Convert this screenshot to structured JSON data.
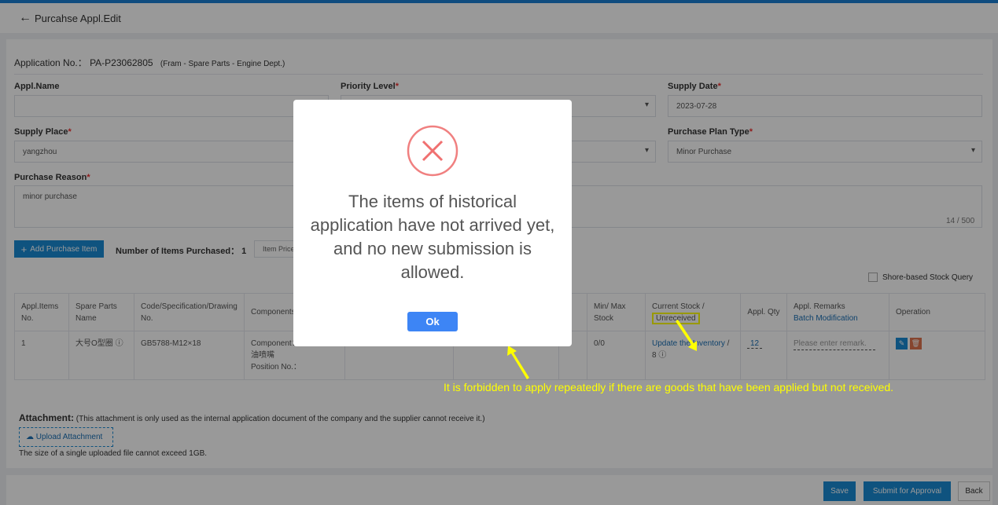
{
  "header": {
    "title": "Purcahse Appl.Edit"
  },
  "application": {
    "label": "Application No.：",
    "number": "PA-P23062805",
    "dept": "(Fram - Spare Parts - Engine Dept.)"
  },
  "form": {
    "appl_name": {
      "label": "Appl.Name",
      "value": ""
    },
    "priority": {
      "label": "Priority Level",
      "value": ""
    },
    "supply_date": {
      "label": "Supply Date",
      "value": "2023-07-28"
    },
    "supply_place": {
      "label": "Supply Place",
      "value": "yangzhou"
    },
    "plan_type": {
      "label": "Purchase Plan Type",
      "value": "Minor Purchase"
    },
    "reason": {
      "label": "Purchase Reason",
      "value": "minor purchase",
      "counter": "14 / 500"
    }
  },
  "toolbar": {
    "add_label": "Add Purchase Item",
    "count_label": "Number of Items Purchased：",
    "count": "1",
    "item_price": "Item Price",
    "stock_query": "Shore-based Stock Query"
  },
  "table": {
    "headers": [
      "Appl.Items No.",
      "Spare Parts Name",
      "Code/Specification/Drawing No.",
      "Components No.",
      "",
      "",
      "",
      "Min/ Max Stock",
      "Current Stock /",
      "Appl. Qty",
      "Appl. Remarks",
      "Operation"
    ],
    "unreceived": "Unreceived",
    "batch": "Batch Modification",
    "row": {
      "no": "1",
      "name": "大号O型圈",
      "code": "GB5788-M12×18",
      "component": "Component：",
      "component_name": "油喷嘴",
      "position": "Position No.：",
      "minmax": "0/0",
      "update": "Update the Inventory",
      "stock": "/ 8",
      "qty": "12",
      "remark_placeholder": "Please enter remark."
    }
  },
  "attachment": {
    "label": "Attachment:",
    "note": "(This attachment is only used as the internal application document of the company and the supplier cannot receive it.)",
    "upload": "Upload Attachment",
    "limit": "The size of a single uploaded file cannot exceed 1GB."
  },
  "footer": {
    "save": "Save",
    "submit": "Submit for Approval",
    "back": "Back"
  },
  "modal": {
    "icon": "error-circle-x",
    "message": "The items of historical application have not arrived yet, and no new submission is allowed.",
    "ok": "Ok"
  },
  "annotation": {
    "text": "It is forbidden to apply repeatedly if there are goods that have been applied but not received.",
    "color": "#ffff00"
  }
}
